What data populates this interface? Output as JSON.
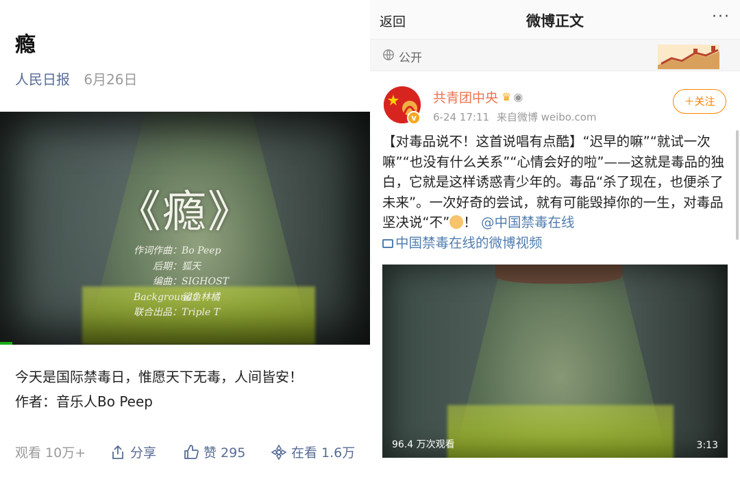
{
  "left": {
    "title": "瘾",
    "source": "人民日报",
    "date": "6月26日",
    "video": {
      "big_title": "《瘾》",
      "credits": [
        {
          "k": "作词作曲：",
          "v": "Bo Peep"
        },
        {
          "k": "后期：",
          "v": "狐天"
        },
        {
          "k": "编曲：",
          "v": "SIGHOST"
        },
        {
          "k": "Background：",
          "v": "鲨鱼林橘"
        },
        {
          "k": "联合出品：",
          "v": "Triple T"
        }
      ]
    },
    "desc_line1": "今天是国际禁毒日，惟愿天下无毒，人间皆安！",
    "desc_line2": "作者：音乐人Bo Peep",
    "actions": {
      "views": "观看 10万+",
      "share": "分享",
      "like": "赞 295",
      "watching": "在看 1.6万"
    },
    "accent_color": "#576b95"
  },
  "right": {
    "topbar": {
      "back": "返回",
      "title": "微博正文",
      "more": "···"
    },
    "visibility": "公开",
    "post": {
      "username": "共青团中央",
      "time": "6-24 17:11",
      "via": "来自微博 weibo.com",
      "follow": "＋关注",
      "text_part1": "【对毒品说不！这首说唱有点酷】“迟早的嘛”“就试一次嘛”“也没有什么关系”“心情会好的啦”——这就是毒品的独白，它就是这样诱惑青少年的。毒品“杀了现在，也便杀了未来”。一次好奇的尝试，就有可能毁掉你的一生，对毒品坚决说“不”",
      "text_part2": "！",
      "mention": "@中国禁毒在线",
      "video_link": "中国禁毒在线的微博视频",
      "video": {
        "plays": "96.4 万次观看",
        "duration": "3:13"
      }
    },
    "colors": {
      "username": "#eb7350",
      "link": "#507daf",
      "follow": "#ff8200"
    }
  }
}
